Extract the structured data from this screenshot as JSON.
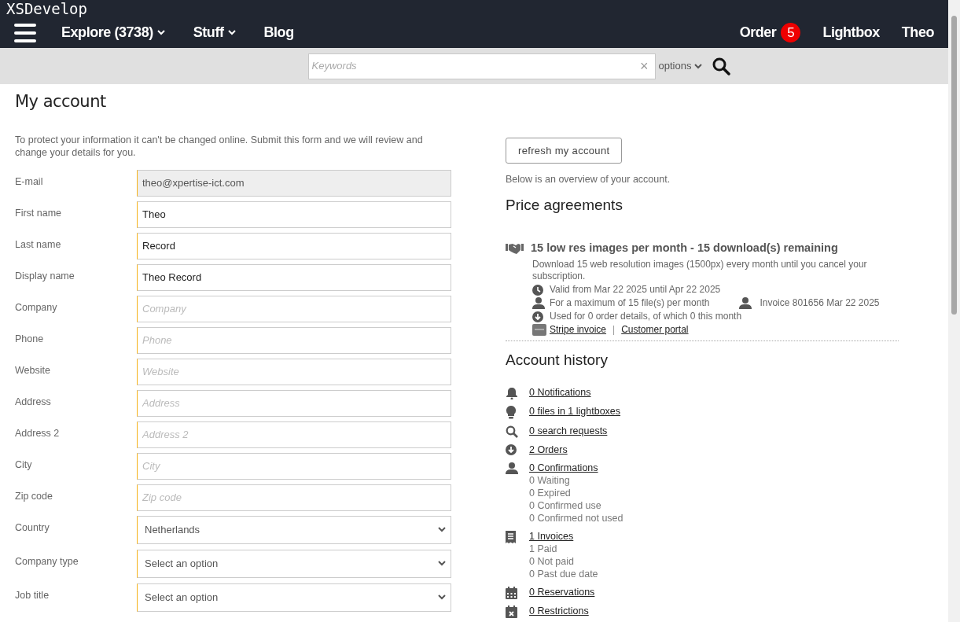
{
  "app_title": "XSDevelop",
  "nav": {
    "left": [
      {
        "label": "Explore (3738)",
        "dropdown": true
      },
      {
        "label": "Stuff",
        "dropdown": true
      },
      {
        "label": "Blog",
        "dropdown": false
      }
    ],
    "right": [
      {
        "label": "Order",
        "badge": "5"
      },
      {
        "label": "Lightbox"
      },
      {
        "label": "Theo"
      }
    ]
  },
  "search": {
    "placeholder": "Keywords",
    "clear": "×",
    "options": "options"
  },
  "page_title": "My account",
  "intro": "To protect your information it can't be changed online. Submit this form and we will review and change your details for you.",
  "fields": [
    {
      "label": "E-mail",
      "kind": "input",
      "value": "theo@xpertise-ict.com",
      "disabled": true
    },
    {
      "label": "First name",
      "kind": "input",
      "value": "Theo",
      "disabled": false
    },
    {
      "label": "Last name",
      "kind": "input",
      "value": "Record",
      "disabled": false
    },
    {
      "label": "Display name",
      "kind": "input",
      "value": "Theo Record",
      "disabled": false
    },
    {
      "label": "Company",
      "kind": "input",
      "placeholder": "Company",
      "disabled": false
    },
    {
      "label": "Phone",
      "kind": "input",
      "placeholder": "Phone",
      "disabled": false
    },
    {
      "label": "Website",
      "kind": "input",
      "placeholder": "Website",
      "disabled": false
    },
    {
      "label": "Address",
      "kind": "input",
      "placeholder": "Address",
      "disabled": false
    },
    {
      "label": "Address 2",
      "kind": "input",
      "placeholder": "Address 2",
      "disabled": false
    },
    {
      "label": "City",
      "kind": "input",
      "placeholder": "City",
      "disabled": false
    },
    {
      "label": "Zip code",
      "kind": "input",
      "placeholder": "Zip code",
      "disabled": false
    },
    {
      "label": "Country",
      "kind": "select",
      "value": "Netherlands"
    },
    {
      "label": "Company type",
      "kind": "select",
      "value": "Select an option"
    },
    {
      "label": "Job title",
      "kind": "select",
      "value": "Select an option"
    }
  ],
  "refresh_button": "refresh my account",
  "overview": "Below is an overview of your account.",
  "price_agreements": {
    "heading": "Price agreements",
    "title": "15 low res images per month - 15 download(s) remaining",
    "description": "Download 15 web resolution images (1500px) every month until you cancel your subscription.",
    "valid": "Valid from Mar 22 2025 until Apr 22 2025",
    "maximum": "For a maximum of 15 file(s)  per month",
    "invoice": "Invoice 801656 Mar 22 2025",
    "used": "Used for 0 order details, of which 0 this month",
    "links": [
      "Stripe invoice",
      "Customer portal"
    ],
    "separator": "|"
  },
  "account_history": {
    "heading": "Account history",
    "items": [
      {
        "kind": "bell",
        "label": "0 Notifications"
      },
      {
        "kind": "bulb",
        "label": "0 files in 1 lightboxes"
      },
      {
        "kind": "search",
        "label": "0 search requests"
      },
      {
        "kind": "download",
        "label": "2 Orders"
      },
      {
        "kind": "person",
        "label": "0 Confirmations",
        "details": [
          "0 Waiting",
          "0 Expired",
          "0 Confirmed use",
          "0 Confirmed not used"
        ]
      },
      {
        "kind": "receipt",
        "label": "1 Invoices",
        "details": [
          "1 Paid",
          "0 Not paid",
          "0 Past due date"
        ]
      },
      {
        "kind": "calendar",
        "label": "0 Reservations"
      },
      {
        "kind": "calendar-x",
        "label": "0 Restrictions"
      }
    ]
  }
}
